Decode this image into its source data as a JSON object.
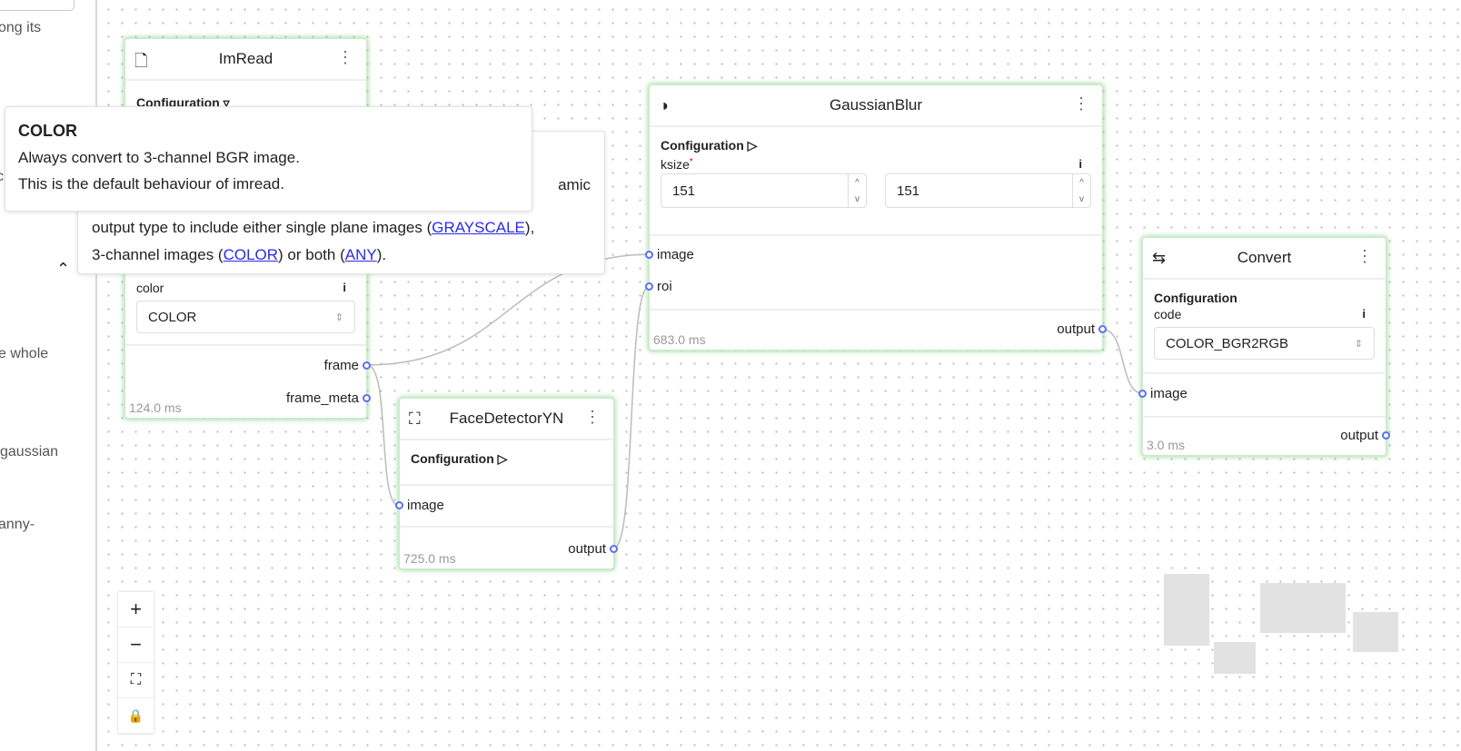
{
  "sidebar": {
    "fragments": [
      "ong its",
      "c",
      "e whole",
      "gaussian",
      "anny-"
    ],
    "collapse_icon": "chevron-up-icon"
  },
  "nodes": {
    "imread": {
      "title": "ImRead",
      "icon": "file-icon",
      "config": "Configuration",
      "color_label": "color",
      "color_value": "COLOR",
      "outputs": [
        "frame",
        "frame_meta"
      ],
      "time": "124.0 ms"
    },
    "gaussian": {
      "title": "GaussianBlur",
      "icon": "contrast-icon",
      "config": "Configuration",
      "ksize_label": "ksize",
      "required": "*",
      "ksize": [
        "151",
        "151"
      ],
      "inputs": [
        "image",
        "roi"
      ],
      "output": "output",
      "time": "683.0 ms"
    },
    "face": {
      "title": "FaceDetectorYN",
      "icon": "face-scan-icon",
      "config": "Configuration",
      "input": "image",
      "output": "output",
      "time": "725.0 ms"
    },
    "convert": {
      "title": "Convert",
      "icon": "convert-icon",
      "config": "Configuration",
      "code_label": "code",
      "code_value": "COLOR_BGR2RGB",
      "input": "image",
      "output": "output",
      "time": "3.0 ms"
    }
  },
  "tooltip_color": {
    "title": "COLOR",
    "line1": "Always convert to 3-channel BGR image.",
    "line2": "This is the default behaviour of imread."
  },
  "tooltip_mode": {
    "frag1": "amic",
    "frag2a": "output type to include either single plane images (",
    "link_gray": "GRAYSCALE",
    "frag2b": "),",
    "frag3a": "3-channel images (",
    "link_color": "COLOR",
    "frag3b": ") or both (",
    "link_any": "ANY",
    "frag3c": ")."
  },
  "controls": {
    "zoom_in": "+",
    "zoom_out": "−",
    "fit": "⛶",
    "lock": "🔒"
  }
}
